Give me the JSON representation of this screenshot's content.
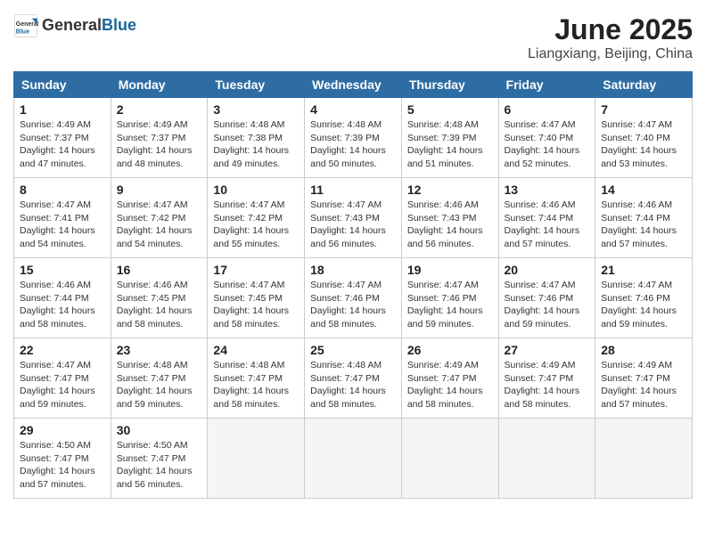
{
  "header": {
    "logo_general": "General",
    "logo_blue": "Blue",
    "title": "June 2025",
    "subtitle": "Liangxiang, Beijing, China"
  },
  "calendar": {
    "days_of_week": [
      "Sunday",
      "Monday",
      "Tuesday",
      "Wednesday",
      "Thursday",
      "Friday",
      "Saturday"
    ],
    "weeks": [
      [
        null,
        null,
        null,
        null,
        null,
        null,
        null
      ]
    ]
  },
  "cells": [
    {
      "day": "1",
      "info": "Sunrise: 4:49 AM\nSunset: 7:37 PM\nDaylight: 14 hours and 47 minutes."
    },
    {
      "day": "2",
      "info": "Sunrise: 4:49 AM\nSunset: 7:37 PM\nDaylight: 14 hours and 48 minutes."
    },
    {
      "day": "3",
      "info": "Sunrise: 4:48 AM\nSunset: 7:38 PM\nDaylight: 14 hours and 49 minutes."
    },
    {
      "day": "4",
      "info": "Sunrise: 4:48 AM\nSunset: 7:39 PM\nDaylight: 14 hours and 50 minutes."
    },
    {
      "day": "5",
      "info": "Sunrise: 4:48 AM\nSunset: 7:39 PM\nDaylight: 14 hours and 51 minutes."
    },
    {
      "day": "6",
      "info": "Sunrise: 4:47 AM\nSunset: 7:40 PM\nDaylight: 14 hours and 52 minutes."
    },
    {
      "day": "7",
      "info": "Sunrise: 4:47 AM\nSunset: 7:40 PM\nDaylight: 14 hours and 53 minutes."
    },
    {
      "day": "8",
      "info": "Sunrise: 4:47 AM\nSunset: 7:41 PM\nDaylight: 14 hours and 54 minutes."
    },
    {
      "day": "9",
      "info": "Sunrise: 4:47 AM\nSunset: 7:42 PM\nDaylight: 14 hours and 54 minutes."
    },
    {
      "day": "10",
      "info": "Sunrise: 4:47 AM\nSunset: 7:42 PM\nDaylight: 14 hours and 55 minutes."
    },
    {
      "day": "11",
      "info": "Sunrise: 4:47 AM\nSunset: 7:43 PM\nDaylight: 14 hours and 56 minutes."
    },
    {
      "day": "12",
      "info": "Sunrise: 4:46 AM\nSunset: 7:43 PM\nDaylight: 14 hours and 56 minutes."
    },
    {
      "day": "13",
      "info": "Sunrise: 4:46 AM\nSunset: 7:44 PM\nDaylight: 14 hours and 57 minutes."
    },
    {
      "day": "14",
      "info": "Sunrise: 4:46 AM\nSunset: 7:44 PM\nDaylight: 14 hours and 57 minutes."
    },
    {
      "day": "15",
      "info": "Sunrise: 4:46 AM\nSunset: 7:44 PM\nDaylight: 14 hours and 58 minutes."
    },
    {
      "day": "16",
      "info": "Sunrise: 4:46 AM\nSunset: 7:45 PM\nDaylight: 14 hours and 58 minutes."
    },
    {
      "day": "17",
      "info": "Sunrise: 4:47 AM\nSunset: 7:45 PM\nDaylight: 14 hours and 58 minutes."
    },
    {
      "day": "18",
      "info": "Sunrise: 4:47 AM\nSunset: 7:46 PM\nDaylight: 14 hours and 58 minutes."
    },
    {
      "day": "19",
      "info": "Sunrise: 4:47 AM\nSunset: 7:46 PM\nDaylight: 14 hours and 59 minutes."
    },
    {
      "day": "20",
      "info": "Sunrise: 4:47 AM\nSunset: 7:46 PM\nDaylight: 14 hours and 59 minutes."
    },
    {
      "day": "21",
      "info": "Sunrise: 4:47 AM\nSunset: 7:46 PM\nDaylight: 14 hours and 59 minutes."
    },
    {
      "day": "22",
      "info": "Sunrise: 4:47 AM\nSunset: 7:47 PM\nDaylight: 14 hours and 59 minutes."
    },
    {
      "day": "23",
      "info": "Sunrise: 4:48 AM\nSunset: 7:47 PM\nDaylight: 14 hours and 59 minutes."
    },
    {
      "day": "24",
      "info": "Sunrise: 4:48 AM\nSunset: 7:47 PM\nDaylight: 14 hours and 58 minutes."
    },
    {
      "day": "25",
      "info": "Sunrise: 4:48 AM\nSunset: 7:47 PM\nDaylight: 14 hours and 58 minutes."
    },
    {
      "day": "26",
      "info": "Sunrise: 4:49 AM\nSunset: 7:47 PM\nDaylight: 14 hours and 58 minutes."
    },
    {
      "day": "27",
      "info": "Sunrise: 4:49 AM\nSunset: 7:47 PM\nDaylight: 14 hours and 58 minutes."
    },
    {
      "day": "28",
      "info": "Sunrise: 4:49 AM\nSunset: 7:47 PM\nDaylight: 14 hours and 57 minutes."
    },
    {
      "day": "29",
      "info": "Sunrise: 4:50 AM\nSunset: 7:47 PM\nDaylight: 14 hours and 57 minutes."
    },
    {
      "day": "30",
      "info": "Sunrise: 4:50 AM\nSunset: 7:47 PM\nDaylight: 14 hours and 56 minutes."
    }
  ]
}
